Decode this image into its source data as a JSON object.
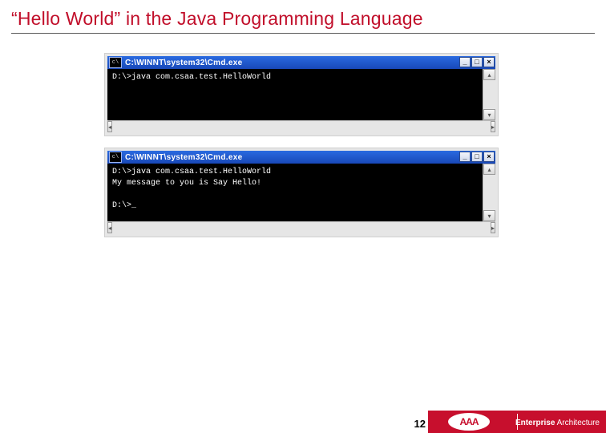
{
  "slide": {
    "title": "“Hello World” in the Java Programming Language",
    "page_number": "12"
  },
  "footer": {
    "brand_text": "AAA",
    "division_bold": "Enterprise",
    "division_rest": " Architecture"
  },
  "windows": [
    {
      "icon_glyph": "c\\",
      "title": "C:\\WINNT\\system32\\Cmd.exe",
      "buttons": {
        "min": "_",
        "max": "□",
        "close": "×"
      },
      "scroll": {
        "up": "▴",
        "down": "▾",
        "left": "◂",
        "right": "▸"
      },
      "terminal": "D:\\>java com.csaa.test.HelloWorld\n"
    },
    {
      "icon_glyph": "c\\",
      "title": "C:\\WINNT\\system32\\Cmd.exe",
      "buttons": {
        "min": "_",
        "max": "□",
        "close": "×"
      },
      "scroll": {
        "up": "▴",
        "down": "▾",
        "left": "◂",
        "right": "▸"
      },
      "terminal": "D:\\>java com.csaa.test.HelloWorld\nMy message to you is Say Hello!\n\nD:\\>_"
    }
  ]
}
